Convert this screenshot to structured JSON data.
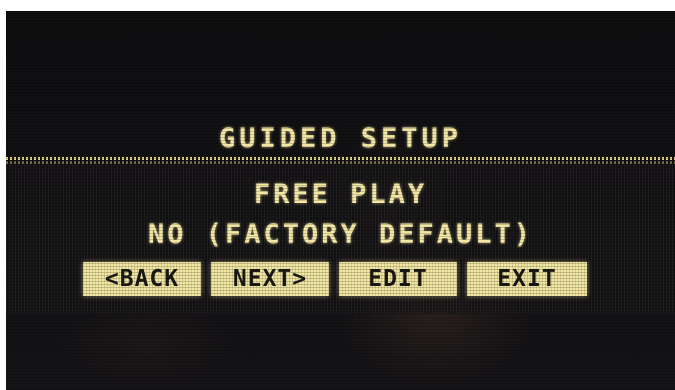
{
  "display": {
    "title": "GUIDED SETUP",
    "setting_name": "FREE PLAY",
    "setting_value": "NO (FACTORY DEFAULT)"
  },
  "buttons": {
    "back": "<BACK",
    "next": "NEXT>",
    "edit": "EDIT",
    "exit": "EXIT"
  },
  "colors": {
    "text": "#f3e7a6",
    "button_bg": "#f1e7a2",
    "screen_bg": "#121113"
  }
}
